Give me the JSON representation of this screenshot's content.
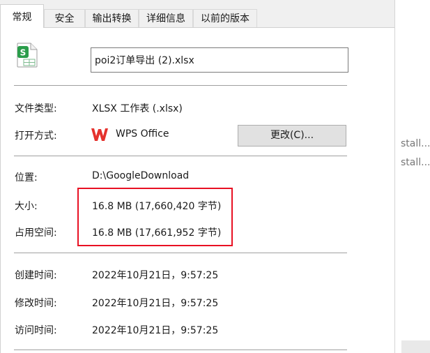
{
  "tabs": [
    {
      "label": "常规",
      "active": true
    },
    {
      "label": "安全",
      "active": false
    },
    {
      "label": "输出转换",
      "active": false
    },
    {
      "label": "详细信息",
      "active": false
    },
    {
      "label": "以前的版本",
      "active": false
    }
  ],
  "file": {
    "icon": "xlsx-spreadsheet-icon",
    "name": "poi2订单导出 (2).xlsx"
  },
  "properties": {
    "type_label": "文件类型:",
    "type_value": "XLSX 工作表 (.xlsx)",
    "opens_with_label": "打开方式:",
    "opens_with_app": "WPS Office",
    "opens_with_icon": "wps-logo-icon",
    "change_button": "更改(C)...",
    "location_label": "位置:",
    "location_value": "D:\\GoogleDownload",
    "size_label": "大小:",
    "size_value": "16.8 MB (17,660,420 字节)",
    "size_on_disk_label": "占用空间:",
    "size_on_disk_value": "16.8 MB (17,661,952 字节)",
    "created_label": "创建时间:",
    "created_value": "2022年10月21日，9:57:25",
    "modified_label": "修改时间:",
    "modified_value": "2022年10月21日，9:57:25",
    "accessed_label": "访问时间:",
    "accessed_value": "2022年10月21日，9:57:25"
  },
  "background_window": {
    "line1": "stall...",
    "line2": "stall..."
  },
  "colors": {
    "highlight": "#e81123",
    "wps_red": "#e5322d",
    "xlsx_green": "#2a9d4a"
  }
}
